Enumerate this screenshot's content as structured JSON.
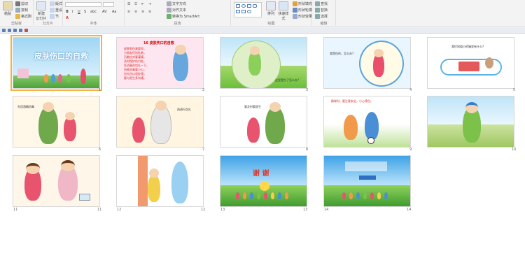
{
  "ribbon": {
    "clipboard": {
      "label": "剪贴板",
      "paste": "粘贴",
      "cut": "剪切",
      "copy": "复制",
      "format_painter": "格式刷"
    },
    "slides": {
      "label": "幻灯片",
      "new_slide": "新建\n幻灯片",
      "layout": "版式",
      "reset": "重设",
      "section": "节"
    },
    "font": {
      "label": "字体"
    },
    "paragraph": {
      "label": "段落",
      "text_direction": "文字方向",
      "align_text": "对齐文本",
      "smartart": "转换为 SmartArt"
    },
    "drawing": {
      "label": "绘图",
      "arrange": "排列",
      "quick_styles": "快速样式",
      "shape_fill": "形状填充",
      "shape_outline": "形状轮廓",
      "shape_effects": "形状效果"
    },
    "editing": {
      "label": "编辑",
      "find": "查找",
      "replace": "替换",
      "select": "选择"
    }
  },
  "slides": [
    {
      "num": "1",
      "title": "皮肤伤口的自救"
    },
    {
      "num": "2",
      "heading": "16 皮肤伤口的自救",
      "lines": [
        "皮肤划伤真要命，",
        "小朋友们别乱跑，",
        "沉着应对要谨慎，",
        "及时保护伤口处，",
        "先消毒再包扎一下，",
        "伤痕消毒要小心，",
        "包扎伤口须处理，",
        "要与医生多沟通。"
      ]
    },
    {
      "num": "3",
      "caption": "这里受伤了怎么办?"
    },
    {
      "num": "4",
      "caption": "我受伤的，怎么办?"
    },
    {
      "num": "5",
      "caption": "我们知道小药箱里有什么?"
    },
    {
      "num": "6",
      "caption": "先用酒精消毒"
    },
    {
      "num": "7",
      "caption": "再进行包扎"
    },
    {
      "num": "8",
      "caption": "要及时看医生"
    },
    {
      "num": "9",
      "caption": "踢球时，要注意安全，小心摔伤。"
    },
    {
      "num": "10"
    },
    {
      "num": "11"
    },
    {
      "num": "12"
    },
    {
      "num": "13",
      "title": "谢  谢"
    },
    {
      "num": "14"
    }
  ],
  "colors": {
    "selected": "#f0b443",
    "ribbon": "#f3f3f3",
    "accent": "#5a7fb5"
  }
}
